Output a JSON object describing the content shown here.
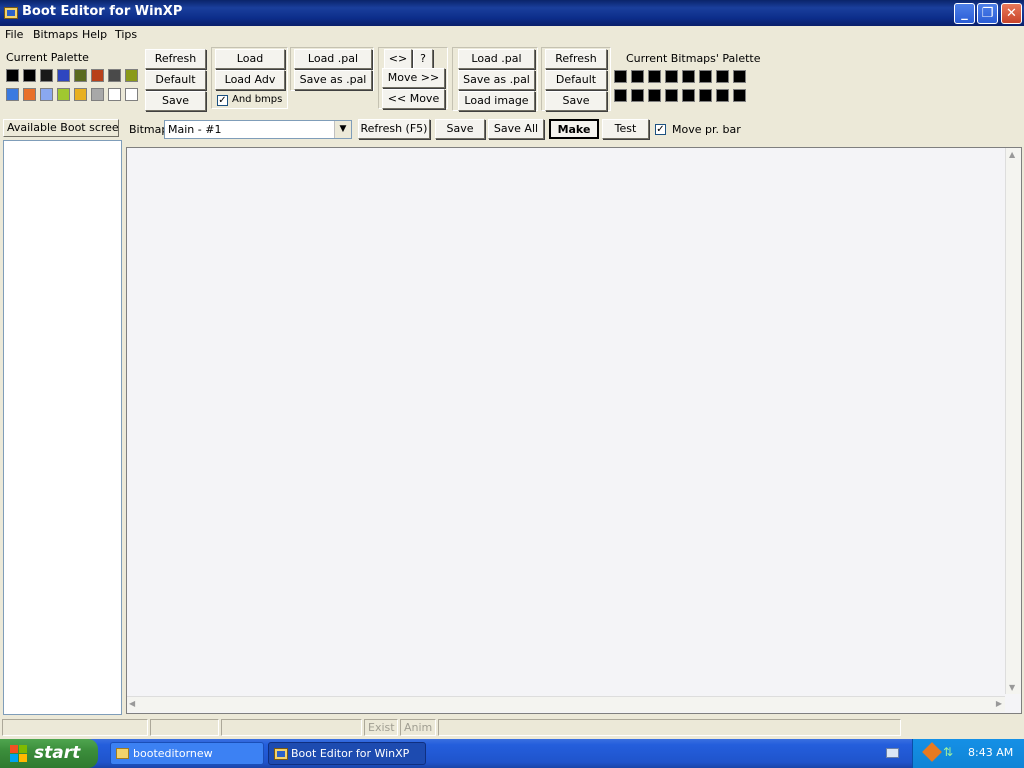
{
  "window": {
    "title": "Boot Editor for WinXP"
  },
  "menu": [
    "File",
    "Bitmaps",
    "Help",
    "Tips"
  ],
  "current_palette": {
    "label": "Current Palette",
    "row1": [
      "#000000",
      "#000000",
      "#1a1a1a",
      "#2e46c0",
      "#5a6a1e",
      "#b8401a",
      "#4a4a4a",
      "#8a9a18"
    ],
    "row2": [
      "#3a7ae0",
      "#e8702a",
      "#8aa8f0",
      "#a0c830",
      "#e8b020",
      "#a8a8a8",
      "#ffffff",
      "#ffffff"
    ]
  },
  "palette_buttons": {
    "refresh": "Refresh",
    "default": "Default",
    "save": "Save"
  },
  "load_group": {
    "load": "Load",
    "load_adv": "Load Adv",
    "and_bmps": "And bmps",
    "and_bmps_checked": true
  },
  "pal_group": {
    "load_pal": "Load .pal",
    "save_as_pal": "Save as .pal"
  },
  "move_group": {
    "swap": "<>",
    "help": "?",
    "move_right": "Move >>",
    "move_left": "<< Move"
  },
  "bitmap_pal_group": {
    "load_pal": "Load .pal",
    "save_as_pal": "Save as .pal",
    "load_image": "Load image"
  },
  "bitmap_palette_buttons": {
    "refresh": "Refresh",
    "default": "Default",
    "save": "Save"
  },
  "bitmaps_palette": {
    "label": "Current Bitmaps' Palette",
    "swatch_color": "#000000"
  },
  "left_panel": {
    "header": "Available Boot screens"
  },
  "bitmap_toolbar": {
    "label": "Bitmap",
    "selected": "Main - #1",
    "refresh": "Refresh (F5)",
    "save": "Save",
    "save_all": "Save All",
    "make": "Make",
    "test": "Test",
    "move_pr_bar": "Move pr. bar",
    "move_pr_bar_checked": true
  },
  "statusbar": {
    "exist": "Exist",
    "anim": "Anim"
  },
  "taskbar": {
    "start": "start",
    "tasks": [
      "booteditornew",
      "Boot Editor for WinXP"
    ],
    "clock": "8:43 AM"
  }
}
